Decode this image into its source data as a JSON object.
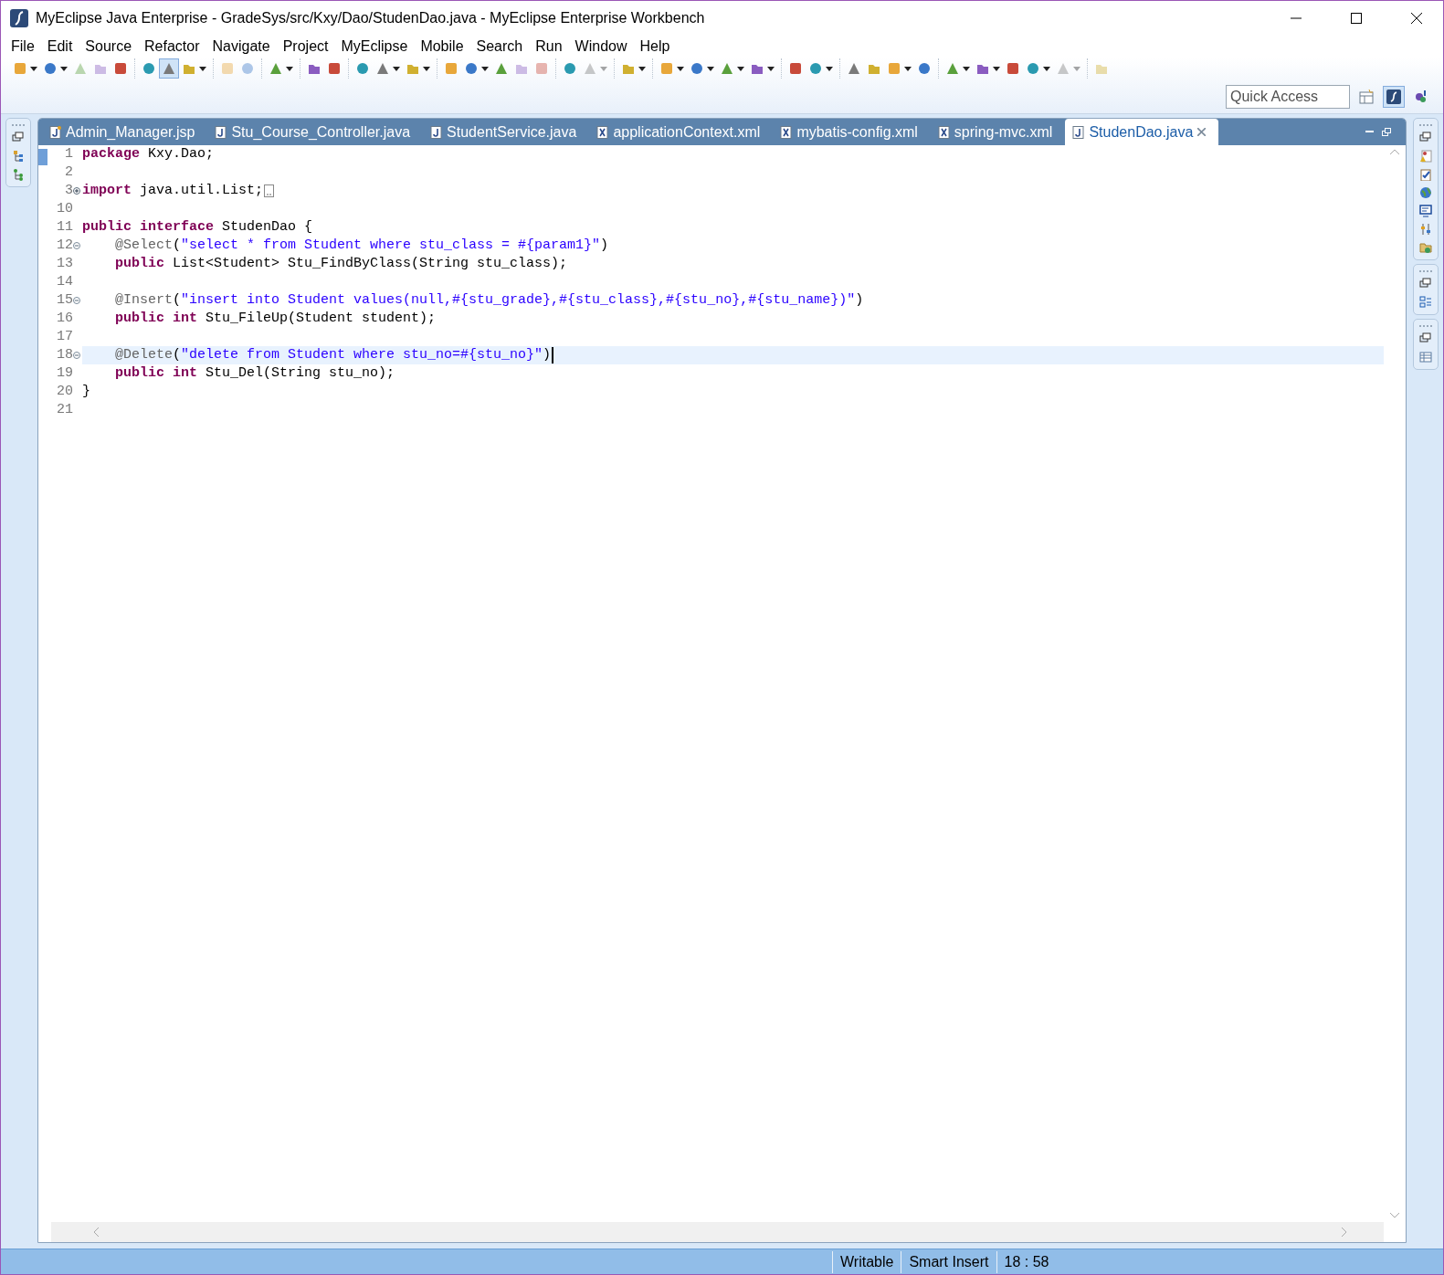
{
  "window": {
    "title": "MyEclipse Java Enterprise - GradeSys/src/Kxy/Dao/StudenDao.java - MyEclipse Enterprise Workbench"
  },
  "menu": [
    "File",
    "Edit",
    "Source",
    "Refactor",
    "Navigate",
    "Project",
    "MyEclipse",
    "Mobile",
    "Search",
    "Run",
    "Window",
    "Help"
  ],
  "toolbar": [
    [
      {
        "dropdown": true,
        "pressed": false,
        "disabled": false
      },
      {
        "dropdown": true,
        "pressed": false,
        "disabled": false
      },
      {
        "dropdown": false,
        "pressed": false,
        "disabled": true
      },
      {
        "dropdown": false,
        "pressed": false,
        "disabled": true
      },
      {
        "dropdown": false,
        "pressed": false,
        "disabled": false
      }
    ],
    [
      {
        "dropdown": false,
        "pressed": false,
        "disabled": false
      },
      {
        "dropdown": false,
        "pressed": true,
        "disabled": false
      },
      {
        "dropdown": true,
        "pressed": false,
        "disabled": false
      }
    ],
    [
      {
        "dropdown": false,
        "pressed": false,
        "disabled": true
      },
      {
        "dropdown": false,
        "pressed": false,
        "disabled": true
      }
    ],
    [
      {
        "dropdown": true,
        "pressed": false,
        "disabled": false
      }
    ],
    [
      {
        "dropdown": false,
        "pressed": false,
        "disabled": false
      },
      {
        "dropdown": false,
        "pressed": false,
        "disabled": false
      }
    ],
    [
      {
        "dropdown": false,
        "pressed": false,
        "disabled": false
      },
      {
        "dropdown": true,
        "pressed": false,
        "disabled": false
      },
      {
        "dropdown": true,
        "pressed": false,
        "disabled": false
      }
    ],
    [
      {
        "dropdown": false,
        "pressed": false,
        "disabled": false
      },
      {
        "dropdown": true,
        "pressed": false,
        "disabled": false
      },
      {
        "dropdown": false,
        "pressed": false,
        "disabled": false
      },
      {
        "dropdown": false,
        "pressed": false,
        "disabled": true
      },
      {
        "dropdown": false,
        "pressed": false,
        "disabled": true
      }
    ],
    [
      {
        "dropdown": false,
        "pressed": false,
        "disabled": false
      },
      {
        "dropdown": true,
        "pressed": false,
        "disabled": true
      }
    ],
    [
      {
        "dropdown": true,
        "pressed": false,
        "disabled": false
      }
    ],
    [
      {
        "dropdown": true,
        "pressed": false,
        "disabled": false
      },
      {
        "dropdown": true,
        "pressed": false,
        "disabled": false
      },
      {
        "dropdown": true,
        "pressed": false,
        "disabled": false
      },
      {
        "dropdown": true,
        "pressed": false,
        "disabled": false
      }
    ],
    [
      {
        "dropdown": false,
        "pressed": false,
        "disabled": false
      },
      {
        "dropdown": true,
        "pressed": false,
        "disabled": false
      }
    ],
    [
      {
        "dropdown": false,
        "pressed": false,
        "disabled": false
      },
      {
        "dropdown": false,
        "pressed": false,
        "disabled": false
      },
      {
        "dropdown": true,
        "pressed": false,
        "disabled": false
      },
      {
        "dropdown": false,
        "pressed": false,
        "disabled": false
      }
    ],
    [
      {
        "dropdown": true,
        "pressed": false,
        "disabled": false
      },
      {
        "dropdown": true,
        "pressed": false,
        "disabled": false
      },
      {
        "dropdown": false,
        "pressed": false,
        "disabled": false
      },
      {
        "dropdown": true,
        "pressed": false,
        "disabled": false
      },
      {
        "dropdown": true,
        "pressed": false,
        "disabled": true
      }
    ],
    [
      {
        "dropdown": false,
        "pressed": false,
        "disabled": true
      }
    ]
  ],
  "quick_access": {
    "placeholder": "Quick Access"
  },
  "perspectives": [
    {
      "selected": false
    },
    {
      "selected": true
    },
    {
      "selected": false
    }
  ],
  "tabs": [
    {
      "label": "Admin_Manager.jsp",
      "kind": "jsp",
      "selected": false
    },
    {
      "label": "Stu_Course_Controller.java",
      "kind": "java",
      "selected": false
    },
    {
      "label": "StudentService.java",
      "kind": "java",
      "selected": false
    },
    {
      "label": "applicationContext.xml",
      "kind": "xml",
      "selected": false
    },
    {
      "label": "mybatis-config.xml",
      "kind": "xml",
      "selected": false
    },
    {
      "label": "spring-mvc.xml",
      "kind": "xml",
      "selected": false
    },
    {
      "label": "StudenDao.java",
      "kind": "java",
      "selected": true
    }
  ],
  "editor": {
    "lines": [
      {
        "number": "1",
        "current": false,
        "indented": false,
        "tokens": [
          {
            "kind": "keyword",
            "text": "package"
          },
          {
            "kind": "plain",
            "text": " Kxy.Dao;"
          }
        ]
      },
      {
        "number": "2",
        "current": false
      },
      {
        "number": "3",
        "current": false,
        "collapsed": true,
        "indented": false,
        "tokens": [
          {
            "kind": "keyword",
            "text": "import"
          },
          {
            "kind": "plain",
            "text": " java.util.List;"
          }
        ]
      },
      {
        "number": "10",
        "current": false
      },
      {
        "number": "11",
        "current": false,
        "indented": false,
        "tokens": [
          {
            "kind": "keyword",
            "text": "public interface"
          },
          {
            "kind": "plain",
            "text": " StudenDao {"
          }
        ]
      },
      {
        "number": "12",
        "current": false,
        "collapsed": false,
        "indented": true,
        "tokens": [
          {
            "kind": "annotation",
            "text": "@Select"
          },
          {
            "kind": "plain",
            "text": "("
          },
          {
            "kind": "string",
            "text": "\"select * from Student where stu_class = #{param1}\""
          },
          {
            "kind": "plain",
            "text": ")"
          }
        ]
      },
      {
        "number": "13",
        "current": false,
        "indented": true,
        "tokens": [
          {
            "kind": "keyword",
            "text": "public"
          },
          {
            "kind": "plain",
            "text": " List<Student> Stu_FindByClass(String stu_class);"
          }
        ]
      },
      {
        "number": "14",
        "current": false
      },
      {
        "number": "15",
        "current": false,
        "collapsed": false,
        "indented": true,
        "tokens": [
          {
            "kind": "annotation",
            "text": "@Insert"
          },
          {
            "kind": "plain",
            "text": "("
          },
          {
            "kind": "string",
            "text": "\"insert into Student values(null,#{stu_grade},#{stu_class},#{stu_no},#{stu_name})\""
          },
          {
            "kind": "plain",
            "text": ")"
          }
        ]
      },
      {
        "number": "16",
        "current": false,
        "indented": true,
        "tokens": [
          {
            "kind": "keyword",
            "text": "public int"
          },
          {
            "kind": "plain",
            "text": " Stu_FileUp(Student student);"
          }
        ]
      },
      {
        "number": "17",
        "current": false
      },
      {
        "number": "18",
        "current": true,
        "collapsed": false,
        "indented": true,
        "tokens": [
          {
            "kind": "annotation",
            "text": "@Delete"
          },
          {
            "kind": "plain",
            "text": "("
          },
          {
            "kind": "string",
            "text": "\"delete from Student where stu_no=#{stu_no}\""
          },
          {
            "kind": "plain",
            "text": ")"
          }
        ]
      },
      {
        "number": "19",
        "current": false,
        "indented": true,
        "tokens": [
          {
            "kind": "keyword",
            "text": "public int"
          },
          {
            "kind": "plain",
            "text": " Stu_Del(String stu_no);"
          }
        ]
      },
      {
        "number": "20",
        "current": false,
        "indented": false,
        "tokens": [
          {
            "kind": "plain",
            "text": "}"
          }
        ]
      },
      {
        "number": "21",
        "current": false
      }
    ]
  },
  "status_bar": [
    "Writable",
    "Smart Insert",
    "18 : 58"
  ]
}
